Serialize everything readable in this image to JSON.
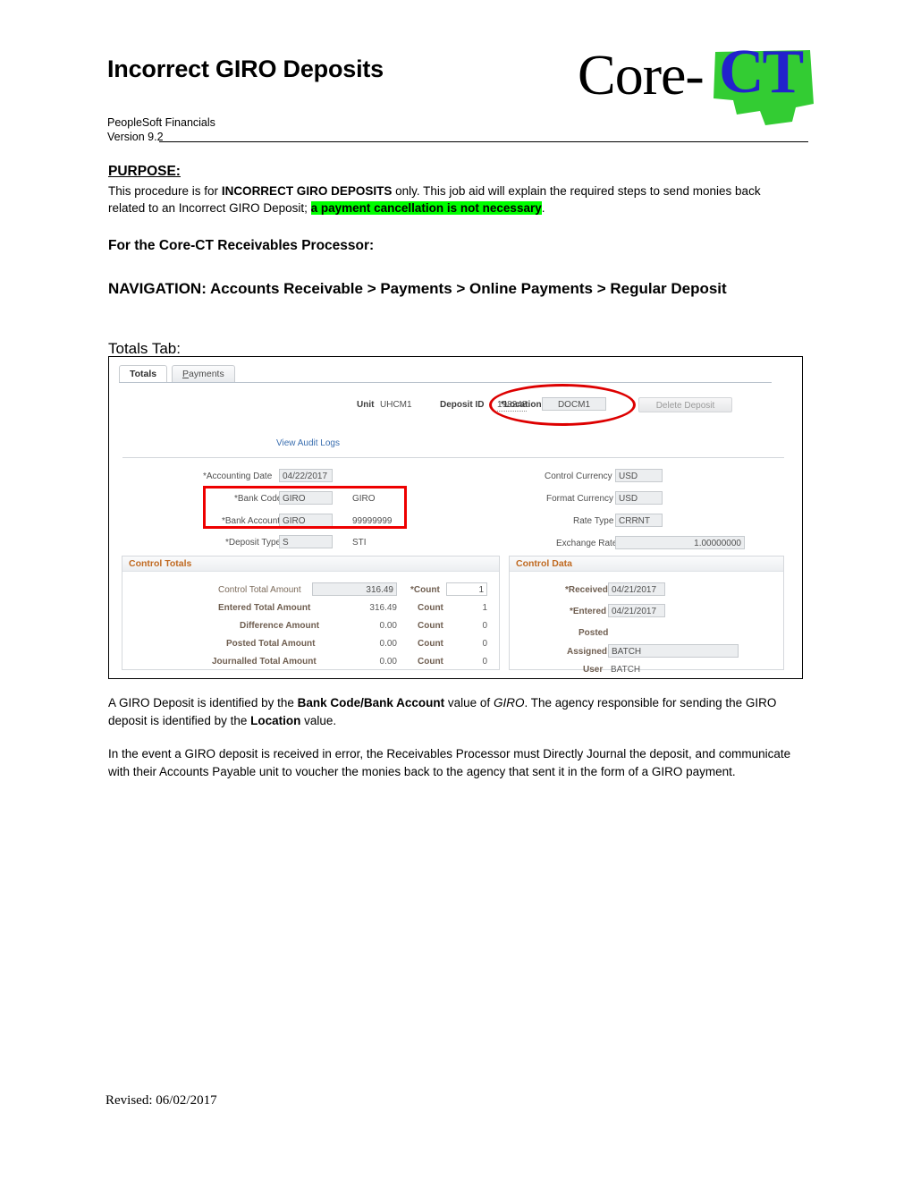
{
  "header": {
    "title": "Incorrect GIRO Deposits",
    "product": "PeopleSoft Financials",
    "version": "Version 9.2",
    "logo": {
      "word": "Core-",
      "mark": "CT",
      "mark_color": "#2222cc",
      "state_color": "#33cc33"
    }
  },
  "purpose": {
    "heading": "PURPOSE:",
    "line_1_a": "This procedure is for ",
    "line_1_bold": "INCORRECT GIRO DEPOSITS",
    "line_1_b": " only.  This job aid will explain the required steps to send monies back related to an Incorrect GIRO Deposit; ",
    "highlight": "a payment cancellation is not necessary",
    "line_1_end": ".",
    "highlight_color": "#00ff00"
  },
  "sections": {
    "processor": "For the Core-CT Receivables Processor:",
    "navigation": "NAVIGATION:  Accounts Receivable > Payments > Online Payments > Regular Deposit",
    "totals_tab": "Totals Tab:"
  },
  "screenshot": {
    "tabs": [
      {
        "label": "Totals",
        "active": true
      },
      {
        "label": "Payments",
        "accesskey": "P",
        "active": false
      }
    ],
    "identity": {
      "unit_label": "Unit",
      "unit_value": "UHCM1",
      "deposit_id_label": "Deposit ID",
      "deposit_id_value": "198248",
      "audit_link": "View Audit Logs",
      "location_label": "*Location",
      "location_value": "DOCM1",
      "delete_button": "Delete Deposit"
    },
    "left_fields": [
      {
        "label": "*Accounting Date",
        "value": "04/22/2017",
        "desc": ""
      },
      {
        "label": "*Bank Code",
        "value": "GIRO",
        "desc": "GIRO"
      },
      {
        "label": "*Bank Account",
        "value": "GIRO",
        "desc": "99999999"
      },
      {
        "label": "*Deposit Type",
        "value": "S",
        "desc": "STI"
      }
    ],
    "right_fields": [
      {
        "label": "Control Currency",
        "value": "USD"
      },
      {
        "label": "Format Currency",
        "value": "USD"
      },
      {
        "label": "Rate Type",
        "value": "CRRNT"
      },
      {
        "label": "Exchange Rate",
        "value": "1.00000000"
      }
    ],
    "control_totals": {
      "heading": "Control Totals",
      "rows": [
        {
          "label": "Control Total Amount",
          "amount": "316.49",
          "count_label": "*Count",
          "count": "1"
        },
        {
          "label": "Entered Total Amount",
          "amount": "316.49",
          "count_label": "Count",
          "count": "1"
        },
        {
          "label": "Difference Amount",
          "amount": "0.00",
          "count_label": "Count",
          "count": "0"
        },
        {
          "label": "Posted Total Amount",
          "amount": "0.00",
          "count_label": "Count",
          "count": "0"
        },
        {
          "label": "Journalled Total Amount",
          "amount": "0.00",
          "count_label": "Count",
          "count": "0"
        }
      ]
    },
    "control_data": {
      "heading": "Control Data",
      "rows": [
        {
          "label": "*Received",
          "value": "04/21/2017"
        },
        {
          "label": "*Entered",
          "value": "04/21/2017"
        },
        {
          "label": "Posted",
          "value": ""
        },
        {
          "label": "Assigned",
          "value": "BATCH"
        },
        {
          "label": "User",
          "value": "BATCH"
        }
      ]
    },
    "annotations": {
      "ellipse_color": "#dd0000",
      "rect_color": "#ee0000"
    }
  },
  "body": {
    "para_a_1": "A GIRO Deposit is identified by the ",
    "para_a_bold": "Bank Code/Bank Account",
    "para_a_2": " value of ",
    "para_a_italic": "GIRO",
    "para_a_3": ".  The agency responsible for sending the GIRO deposit is identified by the ",
    "para_a_bold2": "Location",
    "para_a_4": " value.",
    "para_b": "In the event a GIRO deposit is received in error, the Receivables Processor must Directly Journal the deposit, and communicate with their Accounts Payable unit to voucher the monies back to the agency that sent it in the form of a GIRO payment."
  },
  "footer": {
    "revised": "Revised: 06/02/2017"
  }
}
